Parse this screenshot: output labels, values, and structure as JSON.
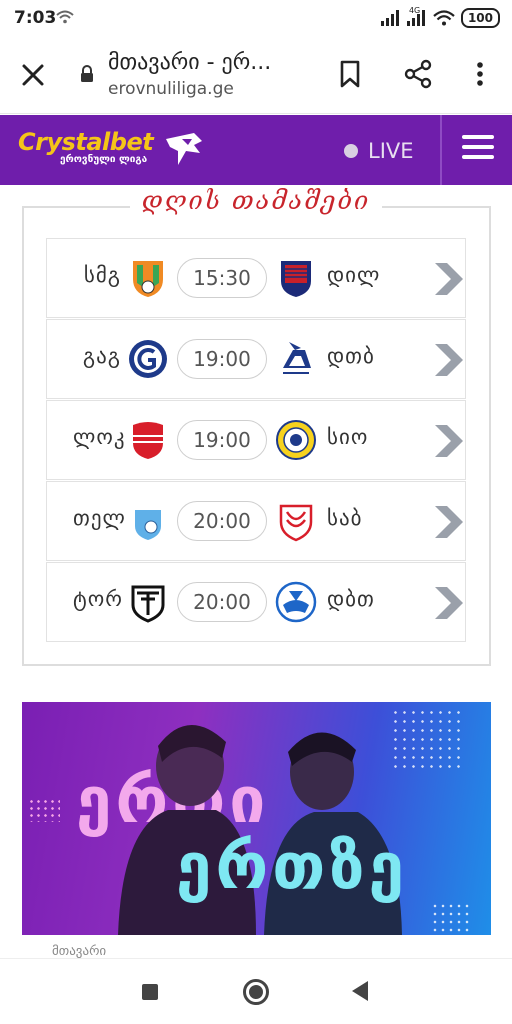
{
  "status_bar": {
    "time": "7:03",
    "network": "4G",
    "battery": "100"
  },
  "browser": {
    "page_title": "მთავარი - ერ...",
    "domain": "erovnuliliga.ge"
  },
  "site_header": {
    "logo_main": "Crystalbet",
    "logo_sub": "ეროვნული ლიგა",
    "live_label": "LIVE",
    "brand_color": "#6f1eab",
    "logo_color": "#f5c518"
  },
  "matches": {
    "title": "დღის თამაშები",
    "title_color": "#c8252c",
    "rows": [
      {
        "home": "სმგ",
        "time": "15:30",
        "away": "დილ"
      },
      {
        "home": "გაგ",
        "time": "19:00",
        "away": "დთბ"
      },
      {
        "home": "ლოკ",
        "time": "19:00",
        "away": "სიო"
      },
      {
        "home": "თელ",
        "time": "20:00",
        "away": "საბ"
      },
      {
        "home": "ტორ",
        "time": "20:00",
        "away": "დბთ"
      }
    ]
  },
  "banner": {
    "line1": "ერთი",
    "line2": "ერთზე"
  },
  "under_banner_text": "მთავარი"
}
